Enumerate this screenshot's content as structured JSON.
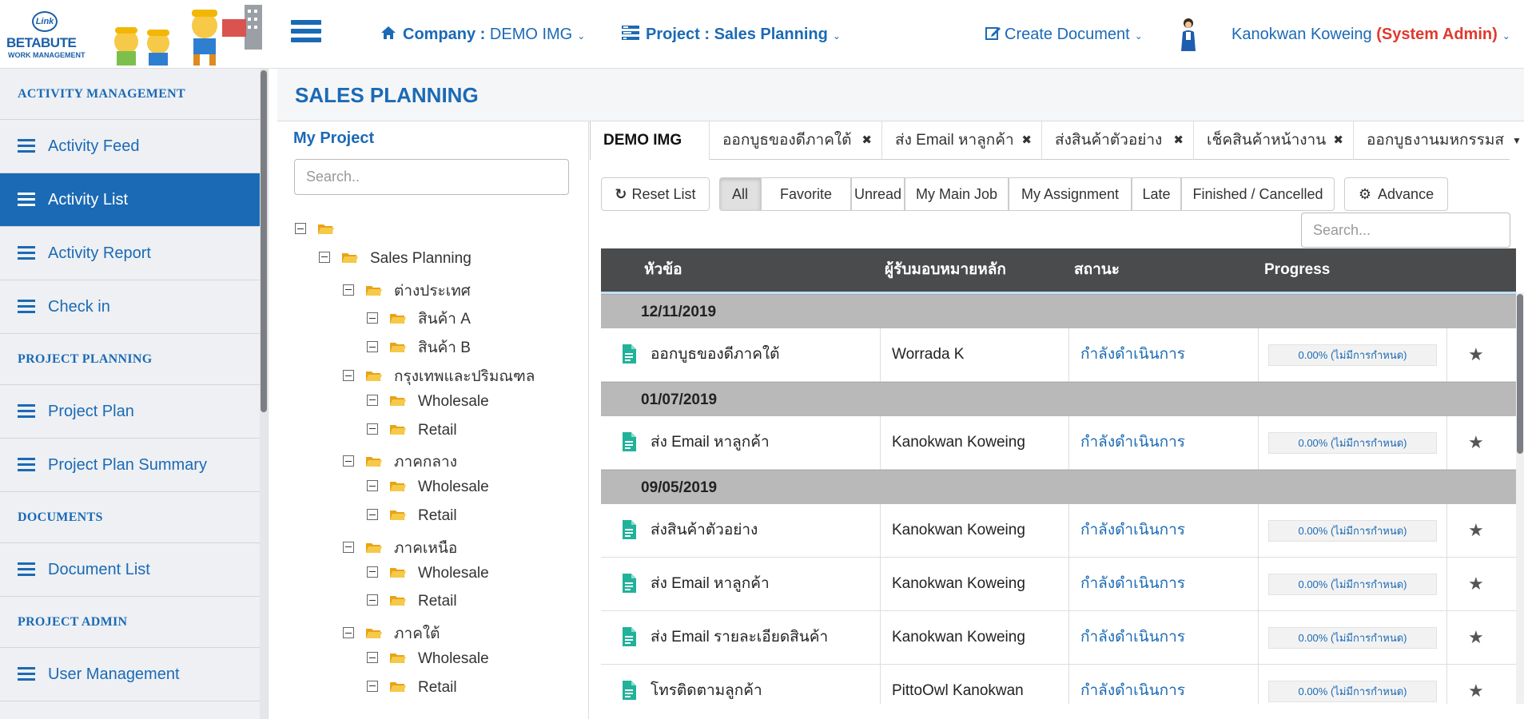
{
  "brand": {
    "badge": "Link",
    "name": "BETABUTE",
    "tagline": "WORK MANAGEMENT"
  },
  "topnav": {
    "company_label": "Company :",
    "company_value": "DEMO IMG",
    "project_label": "Project : Sales Planning",
    "create_document": "Create Document",
    "user_name": "Kanokwan Koweing",
    "user_role": "(System Admin)"
  },
  "sidebar": {
    "sections": [
      {
        "title": "ACTIVITY MANAGEMENT",
        "items": [
          {
            "label": "Activity Feed",
            "active": false
          },
          {
            "label": "Activity List",
            "active": true
          },
          {
            "label": "Activity Report",
            "active": false
          },
          {
            "label": "Check in",
            "active": false
          }
        ]
      },
      {
        "title": "PROJECT PLANNING",
        "items": [
          {
            "label": "Project Plan",
            "active": false
          },
          {
            "label": "Project Plan Summary",
            "active": false
          }
        ]
      },
      {
        "title": "DOCUMENTS",
        "items": [
          {
            "label": "Document List",
            "active": false
          }
        ]
      },
      {
        "title": "PROJECT ADMIN",
        "items": [
          {
            "label": "User Management",
            "active": false
          }
        ]
      }
    ]
  },
  "page": {
    "title": "SALES PLANNING"
  },
  "project_panel": {
    "title": "My Project",
    "search_placeholder": "Search..",
    "tree": [
      {
        "label": "",
        "depth": 0
      },
      {
        "label": "Sales Planning",
        "depth": 1
      },
      {
        "label": "ต่างประเทศ",
        "depth": 2
      },
      {
        "label": "สินค้า A",
        "depth": 3
      },
      {
        "label": "สินค้า B",
        "depth": 3
      },
      {
        "label": "กรุงเทพและปริมณฑล",
        "depth": 2
      },
      {
        "label": "Wholesale",
        "depth": 3
      },
      {
        "label": "Retail",
        "depth": 3
      },
      {
        "label": "ภาคกลาง",
        "depth": 2
      },
      {
        "label": "Wholesale",
        "depth": 3
      },
      {
        "label": "Retail",
        "depth": 3
      },
      {
        "label": "ภาคเหนือ",
        "depth": 2
      },
      {
        "label": "Wholesale",
        "depth": 3
      },
      {
        "label": "Retail",
        "depth": 3
      },
      {
        "label": "ภาคใต้",
        "depth": 2
      },
      {
        "label": "Wholesale",
        "depth": 3
      },
      {
        "label": "Retail",
        "depth": 3
      }
    ]
  },
  "tabs": [
    {
      "label": "DEMO IMG",
      "active": true,
      "closable": false
    },
    {
      "label": "ออกบูธของดีภาคใต้",
      "active": false,
      "closable": true
    },
    {
      "label": "ส่ง Email หาลูกค้า",
      "active": false,
      "closable": true
    },
    {
      "label": "ส่งสินค้าตัวอย่าง",
      "active": false,
      "closable": true
    },
    {
      "label": "เช็คสินค้าหน้างาน",
      "active": false,
      "closable": true
    },
    {
      "label": "ออกบูธงานมหกรรมส",
      "active": false,
      "closable": false
    }
  ],
  "filters": {
    "reset": "Reset List",
    "options": [
      "All",
      "Favorite",
      "Unread",
      "My Main Job",
      "My Assignment",
      "Late",
      "Finished / Cancelled"
    ],
    "selected": "All",
    "advance": "Advance",
    "search_placeholder": "Search..."
  },
  "table": {
    "headers": {
      "title": "หัวข้อ",
      "assignee": "ผู้รับมอบหมายหลัก",
      "status": "สถานะ",
      "progress": "Progress"
    },
    "groups": [
      {
        "date": "12/11/2019",
        "rows": [
          {
            "title": "ออกบูธของดีภาคใต้",
            "assignee": "Worrada K",
            "status": "กำลังดำเนินการ",
            "progress": 0,
            "progress_text": "0.00% (ไม่มีการกำหนด)"
          }
        ]
      },
      {
        "date": "01/07/2019",
        "rows": [
          {
            "title": "ส่ง Email หาลูกค้า",
            "assignee": "Kanokwan Koweing",
            "status": "กำลังดำเนินการ",
            "progress": 0,
            "progress_text": "0.00% (ไม่มีการกำหนด)"
          }
        ]
      },
      {
        "date": "09/05/2019",
        "rows": [
          {
            "title": "ส่งสินค้าตัวอย่าง",
            "assignee": "Kanokwan Koweing",
            "status": "กำลังดำเนินการ",
            "progress": 0,
            "progress_text": "0.00% (ไม่มีการกำหนด)"
          },
          {
            "title": "ส่ง Email หาลูกค้า",
            "assignee": "Kanokwan Koweing",
            "status": "กำลังดำเนินการ",
            "progress": 0,
            "progress_text": "0.00% (ไม่มีการกำหนด)"
          },
          {
            "title": "ส่ง Email รายละเอียดสินค้า",
            "assignee": "Kanokwan Koweing",
            "status": "กำลังดำเนินการ",
            "progress": 0,
            "progress_text": "0.00% (ไม่มีการกำหนด)"
          },
          {
            "title": "โทรติดตามลูกค้า",
            "assignee": "PittoOwl Kanokwan",
            "status": "กำลังดำเนินการ",
            "progress": 0,
            "progress_text": "0.00% (ไม่มีการกำหนด)"
          }
        ]
      }
    ]
  },
  "icons": {
    "menu": "hamburger-icon",
    "company": "home-icon",
    "project": "tasks-icon",
    "create": "edit-icon",
    "reset": "refresh-icon",
    "advance": "cogs-icon",
    "folder": "folder-open-icon",
    "doc": "file-text-icon",
    "star": "star-icon",
    "close": "close-icon",
    "toggle": "minus-square-icon"
  },
  "colors": {
    "brand": "#1b6ab5",
    "admin": "#e0392e",
    "header_bg": "#4a4b4c",
    "group_bg": "#b9b9b9",
    "doc_icon": "#21b29a"
  }
}
